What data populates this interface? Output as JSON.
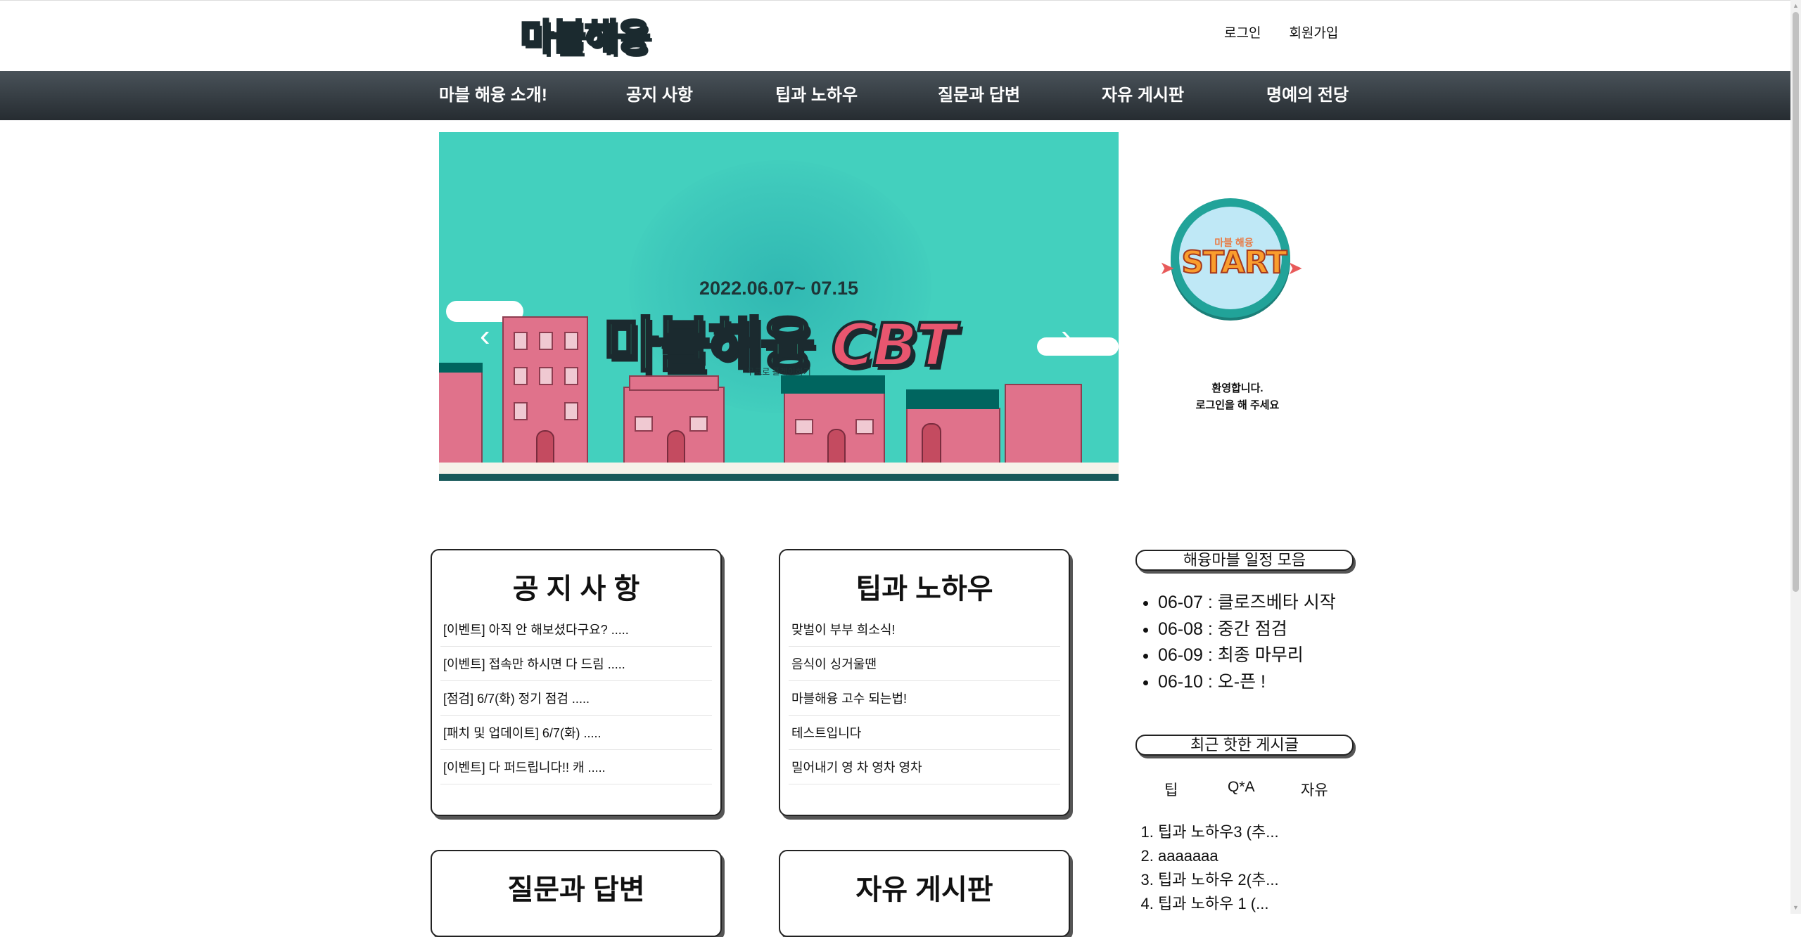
{
  "header": {
    "logo": "마블해융",
    "login": "로그인",
    "signup": "회원가입"
  },
  "nav": {
    "items": [
      "마블 해융 소개!",
      "공지 사항",
      "팁과 노하우",
      "질문과 답변",
      "자유 게시판",
      "명예의 전당"
    ]
  },
  "banner": {
    "date": "2022.06.07~ 07.15",
    "title_a": "마블해융",
    "title_b": "CBT",
    "sub": "무료로 플레이하기",
    "prev": "‹",
    "next": "›"
  },
  "start": {
    "top": "마블 해융",
    "label": "START",
    "welcome_line1": "환영합니다.",
    "welcome_line2": "로그인을 해 주세요"
  },
  "boards": {
    "notice": {
      "title": "공 지 사 항",
      "items": [
        "[이벤트] 아직 안 해보셨다구요? .....",
        "[이벤트] 접속만 하시면 다 드림 .....",
        "[점검] 6/7(화) 정기 점검 .....",
        "[패치 및 업데이트] 6/7(화) .....",
        "[이벤트] 다 퍼드립니다!! 캐 ....."
      ]
    },
    "tips": {
      "title": "팁과 노하우",
      "items": [
        "맞벌이 부부 희소식!",
        "음식이 싱거울땐",
        "마블해융 고수 되는법!",
        "테스트입니다",
        "밀어내기 영 차 영차 영차"
      ]
    },
    "qna": {
      "title": "질문과 답변"
    },
    "free": {
      "title": "자유 게시판"
    }
  },
  "sidebar": {
    "schedule_title": "해융마블 일정 모음",
    "schedule": [
      "06-07 : 클로즈베타 시작",
      "06-08 : 중간 점검",
      "06-09 : 최종 마무리",
      "06-10 : 오-픈 !"
    ],
    "hot_title": "최근 핫한 게시글",
    "tabs": [
      "팁",
      "Q*A",
      "자유"
    ],
    "hot": [
      "팁과 노하우3 (추...",
      "aaaaaaa",
      "팁과 노하우 2(추...",
      "팁과 노하우 1 (..."
    ]
  },
  "colors": {
    "nav_bg": "#2f363c",
    "banner_bg": "#43d0be",
    "accent_green": "#35d8a8",
    "accent_pink": "#e0728b"
  }
}
